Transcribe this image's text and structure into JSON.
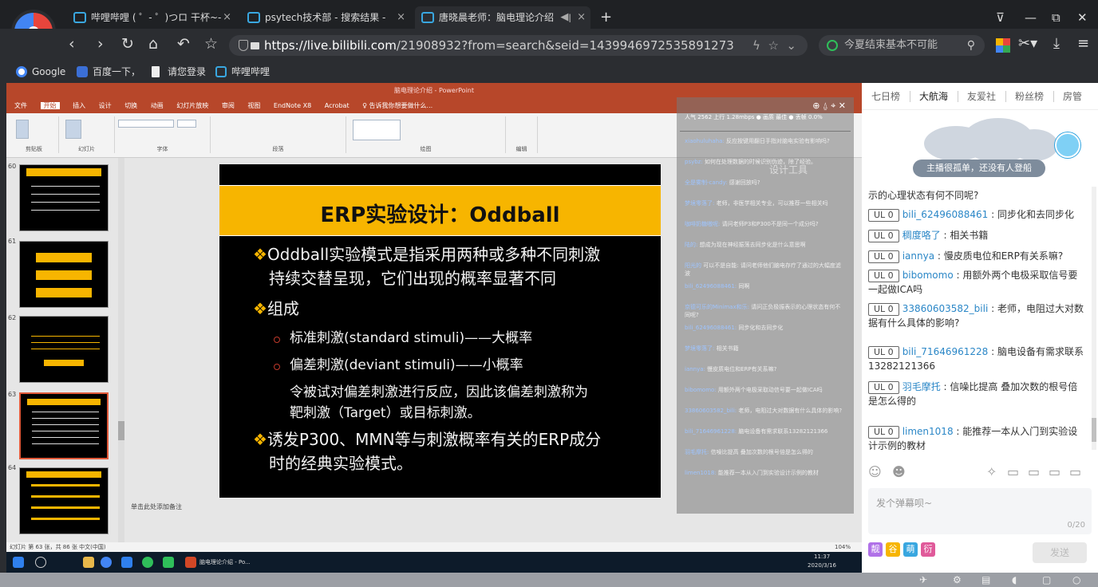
{
  "browser": {
    "tabs": [
      {
        "label": "哔哩哔哩 ( ゜- ゜)つロ 干杯~-"
      },
      {
        "label": "psytech技术部 - 搜索结果 - "
      },
      {
        "label": "唐晓晨老师：脑电理论介绍"
      }
    ],
    "url_host": "https://live.bilibili.com",
    "url_path": "/21908932?from=search&seid=1439946972535891273",
    "search_text": "今夏结束基本不可能",
    "bookmarks": [
      "Google",
      "百度一下，",
      "请您登录",
      "哔哩哔哩"
    ]
  },
  "ppt": {
    "window_title": "脑电理论介绍 - PowerPoint",
    "tabs": [
      "文件",
      "开始",
      "插入",
      "设计",
      "切换",
      "动画",
      "幻灯片放映",
      "审阅",
      "视图",
      "EndNote X8",
      "Acrobat",
      "♀ 告诉我你想要做什么..."
    ],
    "group_labels": [
      "剪贴板",
      "幻灯片",
      "字体",
      "段落",
      "绘图",
      "编辑"
    ],
    "slide_numbers": [
      "60",
      "61",
      "62",
      "63",
      "64"
    ],
    "thumb_labels": [
      "脑电采集电极系统",
      "ERP简介",
      "ERP数据采集",
      "ERP实验设计",
      "ERP实验设计"
    ],
    "slide": {
      "title": "ERP实验设计：Oddball",
      "line1": "Oddball实验模式是指采用两种或多种不同刺激",
      "line2": "持续交替呈现，它们出现的概率显著不同",
      "line3": "组成",
      "sub1": "标准刺激(standard stimuli)——大概率",
      "sub2": "偏差刺激(deviant stimuli)——小概率",
      "sub3": "令被试对偏差刺激进行反应，因此该偏差刺激称为",
      "sub4": "靶刺激（Target）或目标刺激。",
      "line4": "诱发P300、MMN等与刺激概率有关的ERP成分",
      "line5": "时的经典实验模式。"
    },
    "notes_placeholder": "单击此处添加备注",
    "status": "幻灯片 第 63 张，共 86 张   中文(中国)",
    "zoom": "104%",
    "clock_time": "11:37",
    "clock_date": "2020/3/16",
    "taskbar_app": "脑电理论介绍 - Po..."
  },
  "overlay": {
    "stats": "人气 2562   上行 1.28mbps   ● 画质 最佳   ● 丢帧 0.0%",
    "design_label": "设计工具",
    "messages": [
      {
        "user": "xiaohuluhaha:",
        "text": "反应按键用翻日手指对脑电实验有影响吗?"
      },
      {
        "user": "psybz:",
        "text": "如何在处理数据的时候识别伪迹，除了经验。"
      },
      {
        "user": "全是雾制-candy:",
        "text": "感谢回放吗?"
      },
      {
        "user": "梦境零落了:",
        "text": "老师，非医学相关专业，可以推荐一些相关吗"
      },
      {
        "user": "咖啡奶糖嗷呢:",
        "text": "请问老师P3和P300不是同一个成分吗?"
      },
      {
        "user": "陆的:",
        "text": "想成为现在神经振荡去同步化是什么意思啊"
      },
      {
        "user": "阳光的",
        "text": "可以不是自能: 请问老师他们脑电存疗了通过的大幅度滤波"
      },
      {
        "user": "bili_62496088461:",
        "text": "同啊"
      },
      {
        "user": "京德可乐的Minimax和乐:",
        "text": "请问正负极振表示的心理状态有何不同呢?"
      },
      {
        "user": "bili_62496088461:",
        "text": "同步化和去同步化"
      },
      {
        "user": "梦境零落了:",
        "text": "相关书籍"
      },
      {
        "user": "iannya:",
        "text": "慢皮质电位和ERP有关系嘛?"
      },
      {
        "user": "bibomomo:",
        "text": "用额外两个电极采取动信号要一起做ICA吗"
      },
      {
        "user": "33860603582_bili:",
        "text": "老师，电阻过大对数据有什么具体的影响?"
      },
      {
        "user": "bili_71646961228:",
        "text": "脑电设备有需求联系13282121366"
      },
      {
        "user": "羽毛摩托:",
        "text": "信噪比提高 叠加次数的根号倍是怎么得的"
      },
      {
        "user": "limen1018:",
        "text": "能推荐一本从入门到实验设计示例的教材"
      }
    ]
  },
  "side": {
    "tabs": [
      "七日榜",
      "大航海",
      "友爱社",
      "粉丝榜",
      "房管"
    ],
    "banner_text": "主播很孤单，还没有人登船",
    "partial_line": "示的心理状态有何不同呢?",
    "badge": "UL 0",
    "chat": [
      {
        "user": "bili_62496088461",
        "text": "同步化和去同步化"
      },
      {
        "user": "稠度咯了",
        "text": "相关书籍"
      },
      {
        "user": "iannya",
        "text": "慢皮质电位和ERP有关系嘛?"
      },
      {
        "user": "bibomomo",
        "text": "用额外两个电极采取信号要一起做ICA吗"
      },
      {
        "user": "33860603582_bili",
        "text": "老师，电阻过大对数据有什么具体的影响?"
      },
      {
        "user": "bili_71646961228",
        "text": "脑电设备有需求联系13282121366"
      },
      {
        "user": "羽毛摩托",
        "text": "信噪比提高 叠加次数的根号倍是怎么得的"
      },
      {
        "user": "limen1018",
        "text": "能推荐一本从入门到实验设计示例的教材"
      }
    ],
    "input_placeholder": "发个弹幕呗~",
    "counter": "0/20",
    "emotes": [
      "靓",
      "谷",
      "萌",
      "衍"
    ],
    "send_label": "发送"
  }
}
